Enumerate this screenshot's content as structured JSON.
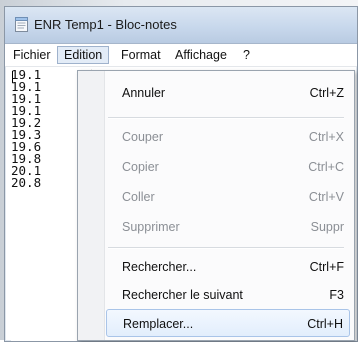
{
  "window": {
    "title": "ENR Temp1 - Bloc-notes"
  },
  "menu": {
    "items": [
      {
        "label": "Fichier"
      },
      {
        "label": "Edition"
      },
      {
        "label": "Format"
      },
      {
        "label": "Affichage"
      },
      {
        "label": "?"
      }
    ],
    "active": "Edition"
  },
  "editor": {
    "lines": [
      "19.1",
      "19.1",
      "19.1",
      "19.1",
      "19.2",
      "19.3",
      "19.6",
      "19.8",
      "20.1",
      "20.8"
    ]
  },
  "edition_menu": {
    "items": [
      {
        "label": "Annuler",
        "shortcut": "Ctrl+Z",
        "enabled": true
      },
      {
        "label": "Couper",
        "shortcut": "Ctrl+X",
        "enabled": false
      },
      {
        "label": "Copier",
        "shortcut": "Ctrl+C",
        "enabled": false
      },
      {
        "label": "Coller",
        "shortcut": "Ctrl+V",
        "enabled": false
      },
      {
        "label": "Supprimer",
        "shortcut": "Suppr",
        "enabled": false
      },
      {
        "label": "Rechercher...",
        "shortcut": "Ctrl+F",
        "enabled": true
      },
      {
        "label": "Rechercher le suivant",
        "shortcut": "F3",
        "enabled": true
      },
      {
        "label": "Remplacer...",
        "shortcut": "Ctrl+H",
        "enabled": true,
        "highlighted": true
      }
    ]
  },
  "icons": {
    "title_app_icon": "notepad-icon"
  },
  "colors": {
    "menu_highlight": "#e2eefc",
    "menu_highlight_border": "#a9c4e8",
    "disabled_text": "#8b8f95"
  }
}
